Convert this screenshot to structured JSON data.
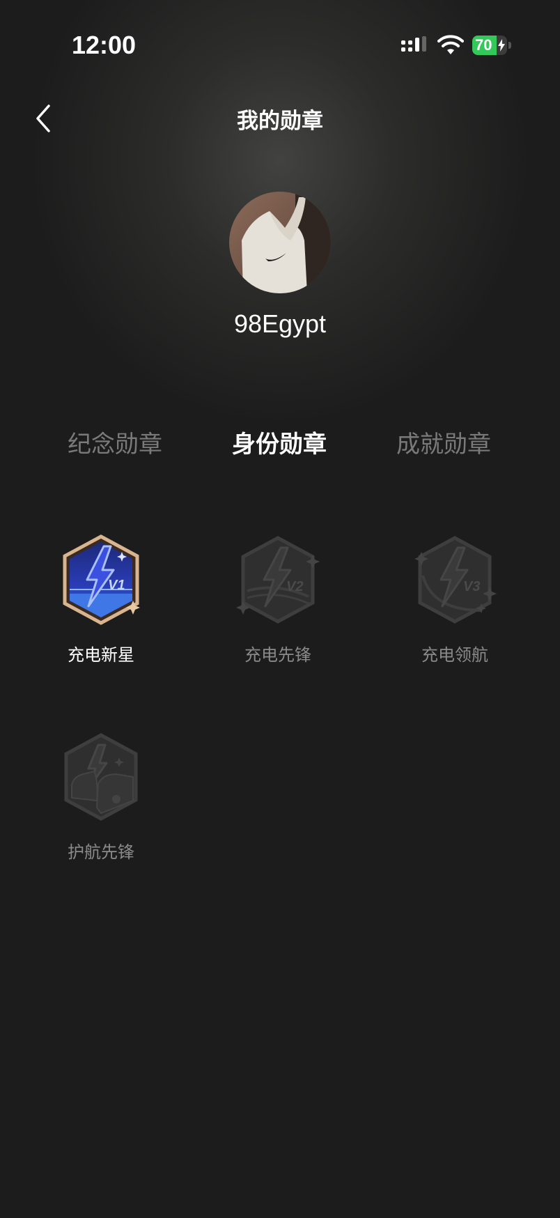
{
  "status_bar": {
    "time": "12:00",
    "battery_level": "70",
    "battery_percent": 70,
    "battery_color": "#34c759"
  },
  "header": {
    "back_icon": "chevron-left-icon",
    "title": "我的勋章"
  },
  "profile": {
    "username": "98Egypt"
  },
  "tabs": [
    {
      "label": "纪念勋章",
      "active": false
    },
    {
      "label": "身份勋章",
      "active": true
    },
    {
      "label": "成就勋章",
      "active": false
    }
  ],
  "badges": [
    {
      "label": "充电新星",
      "level": "V1",
      "earned": true
    },
    {
      "label": "充电先锋",
      "level": "V2",
      "earned": false
    },
    {
      "label": "充电领航",
      "level": "V3",
      "earned": false
    },
    {
      "label": "护航先锋",
      "earned": false
    }
  ],
  "colors": {
    "background": "#1c1c1c",
    "earned_badge_blue": "#2d45c8",
    "earned_badge_border": "#d8b58e",
    "locked_badge": "#3b3b3b"
  }
}
